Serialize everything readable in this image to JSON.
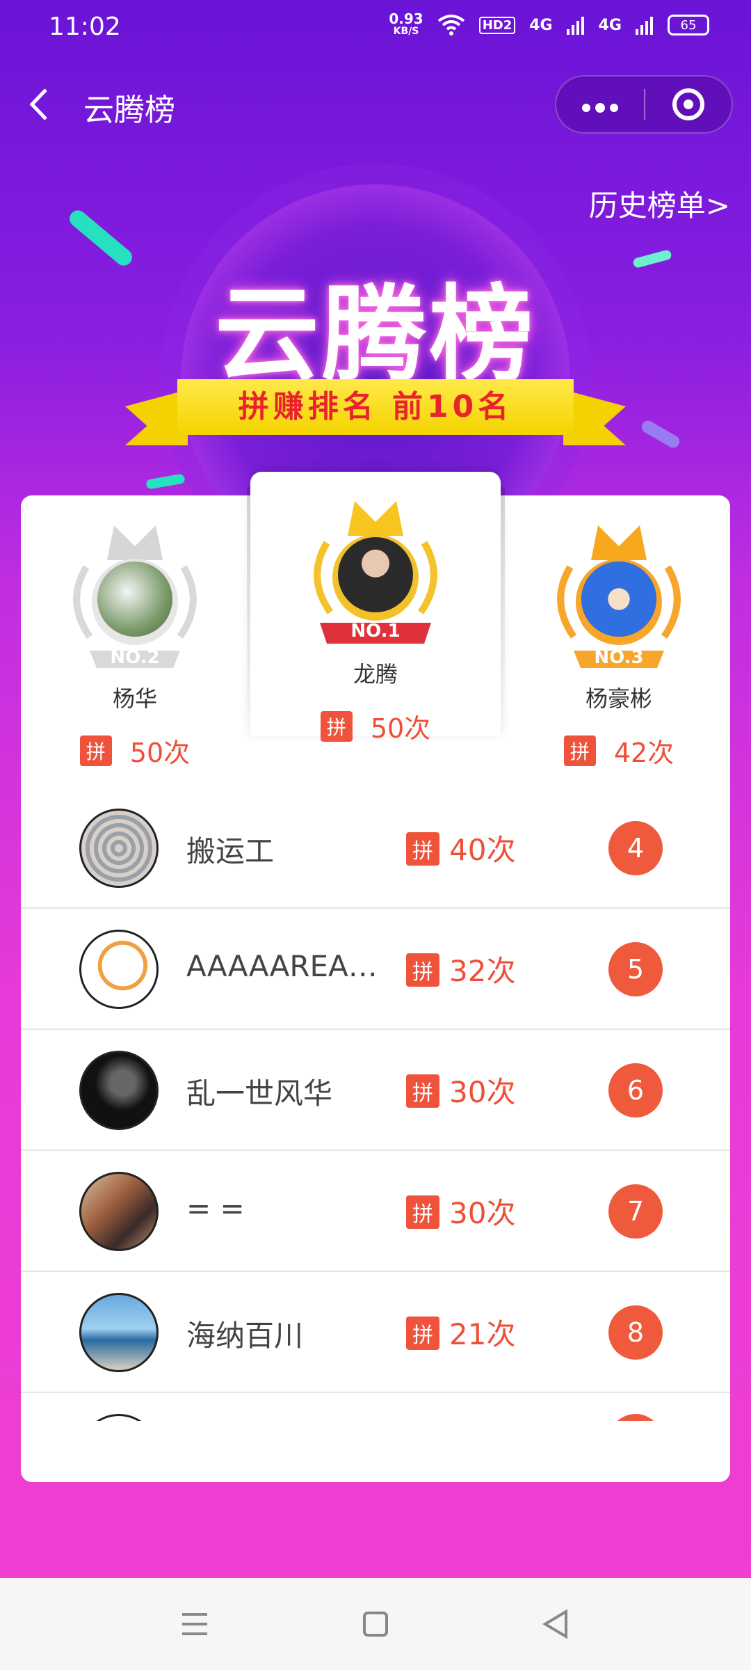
{
  "status_bar": {
    "time": "11:02",
    "speed_value": "0.93",
    "speed_unit": "KB/S",
    "hd": "HD2",
    "net1": "4G",
    "net2": "4G",
    "battery": "65"
  },
  "nav": {
    "title": "云腾榜",
    "more_icon": "more-dots-icon",
    "close_icon": "target-icon"
  },
  "history_link": "历史榜单>",
  "hero": {
    "title": "云腾榜",
    "subtitle": "拼赚排名 前10名"
  },
  "colors": {
    "accent": "#f0533b",
    "bg_top": "#6a14d6",
    "bg_bottom": "#f03fd0",
    "ribbon": "#f5d300"
  },
  "pin_label": "拼",
  "podium": [
    {
      "rank_label": "NO.2",
      "name": "杨华",
      "count": "50次"
    },
    {
      "rank_label": "NO.1",
      "name": "龙腾",
      "count": "50次"
    },
    {
      "rank_label": "NO.3",
      "name": "杨豪彬",
      "count": "42次"
    }
  ],
  "list": [
    {
      "name": "搬运工",
      "count": "40次",
      "rank": "4"
    },
    {
      "name": "AAAAAREAL...",
      "count": "32次",
      "rank": "5"
    },
    {
      "name": "乱一世风华",
      "count": "30次",
      "rank": "6"
    },
    {
      "name": "= =",
      "count": "30次",
      "rank": "7"
    },
    {
      "name": "海纳百川",
      "count": "21次",
      "rank": "8"
    }
  ]
}
